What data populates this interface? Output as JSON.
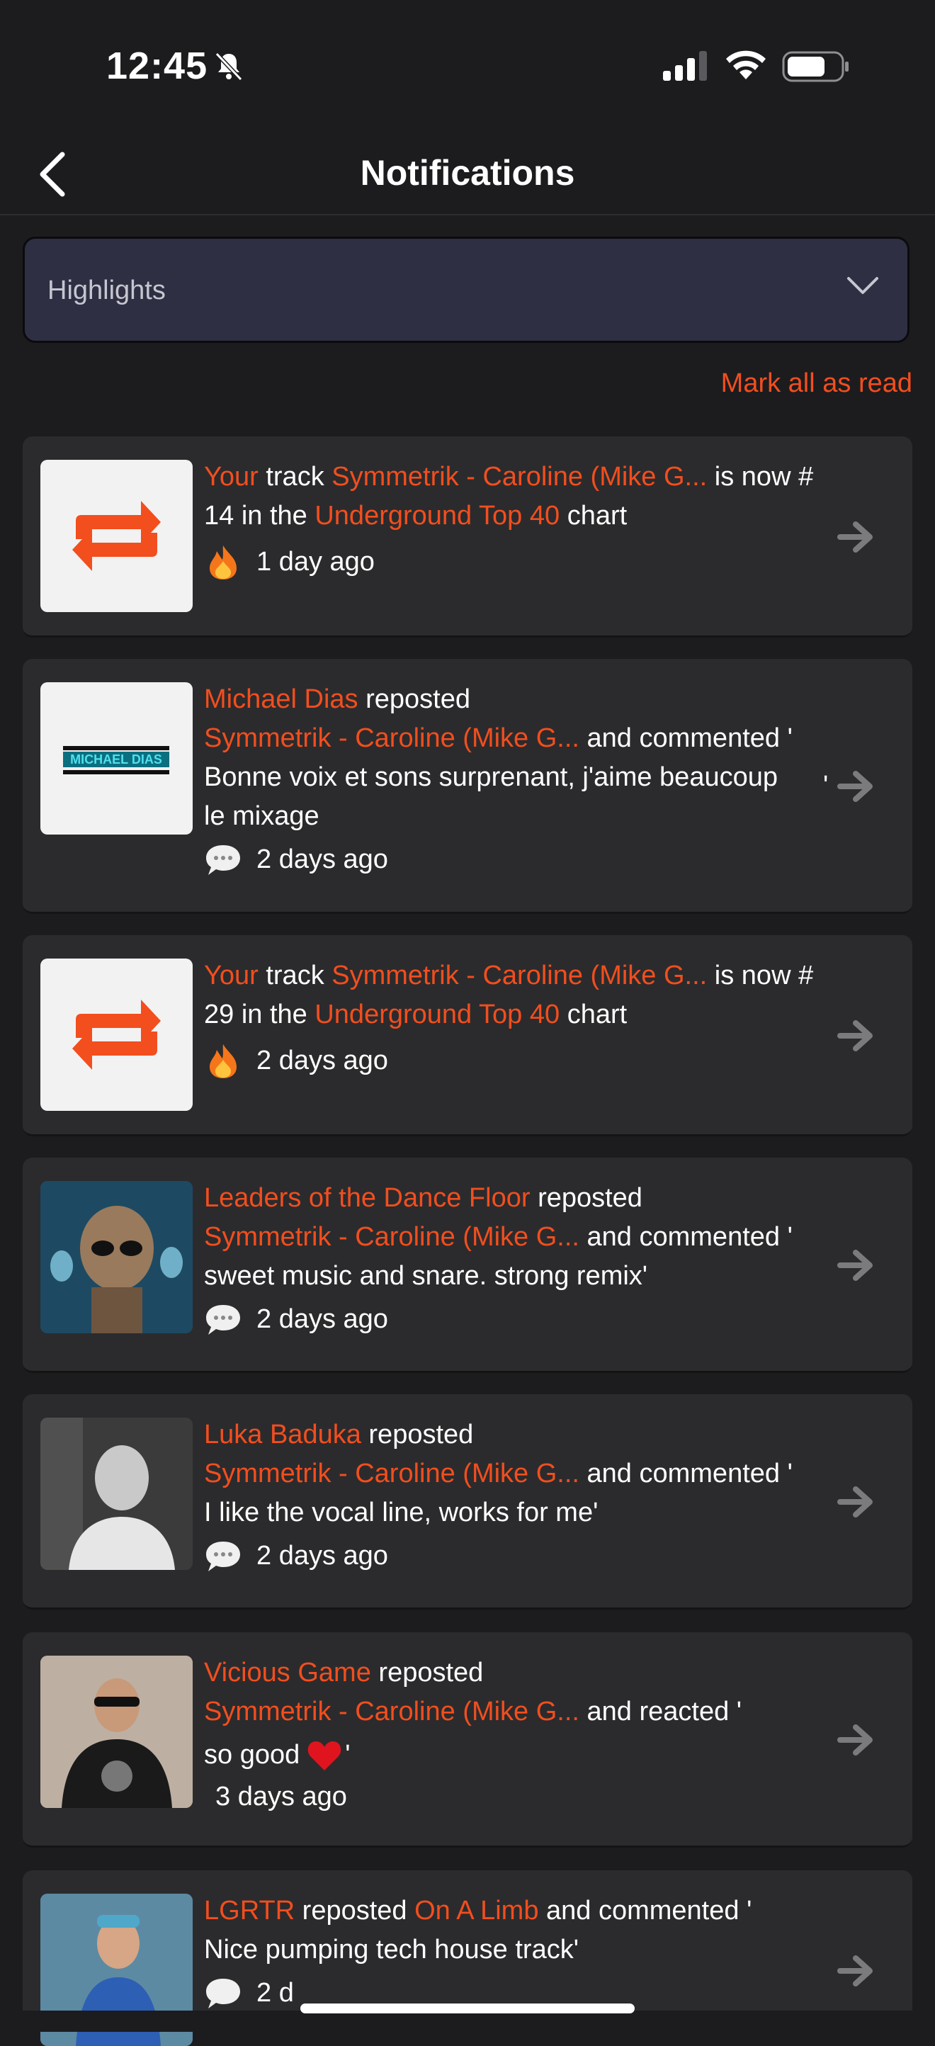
{
  "status_bar": {
    "time": "12:45"
  },
  "nav": {
    "title": "Notifications"
  },
  "filter": {
    "selected": "Highlights"
  },
  "actions": {
    "mark_all_read": "Mark all as read"
  },
  "notifications": [
    {
      "type": "chart",
      "actor": "Your",
      "verb": "track",
      "track": "Symmetrik - Caroline (Mike G...",
      "rest1": "is now #",
      "line2a": "14 in the",
      "chart": "Underground Top 40",
      "line2b": "chart",
      "time": "1 day ago",
      "icon": "fire-icon"
    },
    {
      "type": "comment",
      "actor": "Michael Dias",
      "verb": "reposted",
      "track": "Symmetrik - Caroline (Mike G...",
      "action": "and commented '",
      "comment": "Bonne voix et sons surprenant, j'aime beaucoup le mixage",
      "quote_end": "'",
      "time": "2 days ago",
      "icon": "speech-bubble-icon",
      "thumb_text": "MICHAEL DIAS"
    },
    {
      "type": "chart",
      "actor": "Your",
      "verb": "track",
      "track": "Symmetrik - Caroline (Mike G...",
      "rest1": "is now #",
      "line2a": "29 in the",
      "chart": "Underground Top 40",
      "line2b": "chart",
      "time": "2 days ago",
      "icon": "fire-icon"
    },
    {
      "type": "comment",
      "actor": "Leaders of the Dance Floor",
      "verb": "reposted",
      "track": "Symmetrik - Caroline (Mike G...",
      "action": "and commented '",
      "comment": "sweet music and snare. strong remix'",
      "time": "2 days ago",
      "icon": "speech-bubble-icon"
    },
    {
      "type": "comment",
      "actor": "Luka Baduka",
      "verb": "reposted",
      "track": "Symmetrik - Caroline (Mike G...",
      "action": "and commented '",
      "comment": "I like the vocal line, works for me'",
      "time": "2 days ago",
      "icon": "speech-bubble-icon"
    },
    {
      "type": "reaction",
      "actor": "Vicious Game",
      "verb": "reposted",
      "track": "Symmetrik - Caroline (Mike G...",
      "action": "and reacted '",
      "reaction_a": "so good",
      "reaction_b": "'",
      "time": "3 days ago",
      "icon": "heart-icon"
    },
    {
      "type": "comment",
      "actor": "LGRTR",
      "verb": "reposted",
      "track": "On A Limb",
      "action": "and commented '",
      "comment": "Nice pumping tech house track'",
      "time": "2 d",
      "icon": "speech-bubble-icon"
    }
  ],
  "colors": {
    "accent": "#f24e1e",
    "card": "#2b2b2d",
    "background": "#1c1c1e",
    "dropdown": "#2e2f42"
  }
}
